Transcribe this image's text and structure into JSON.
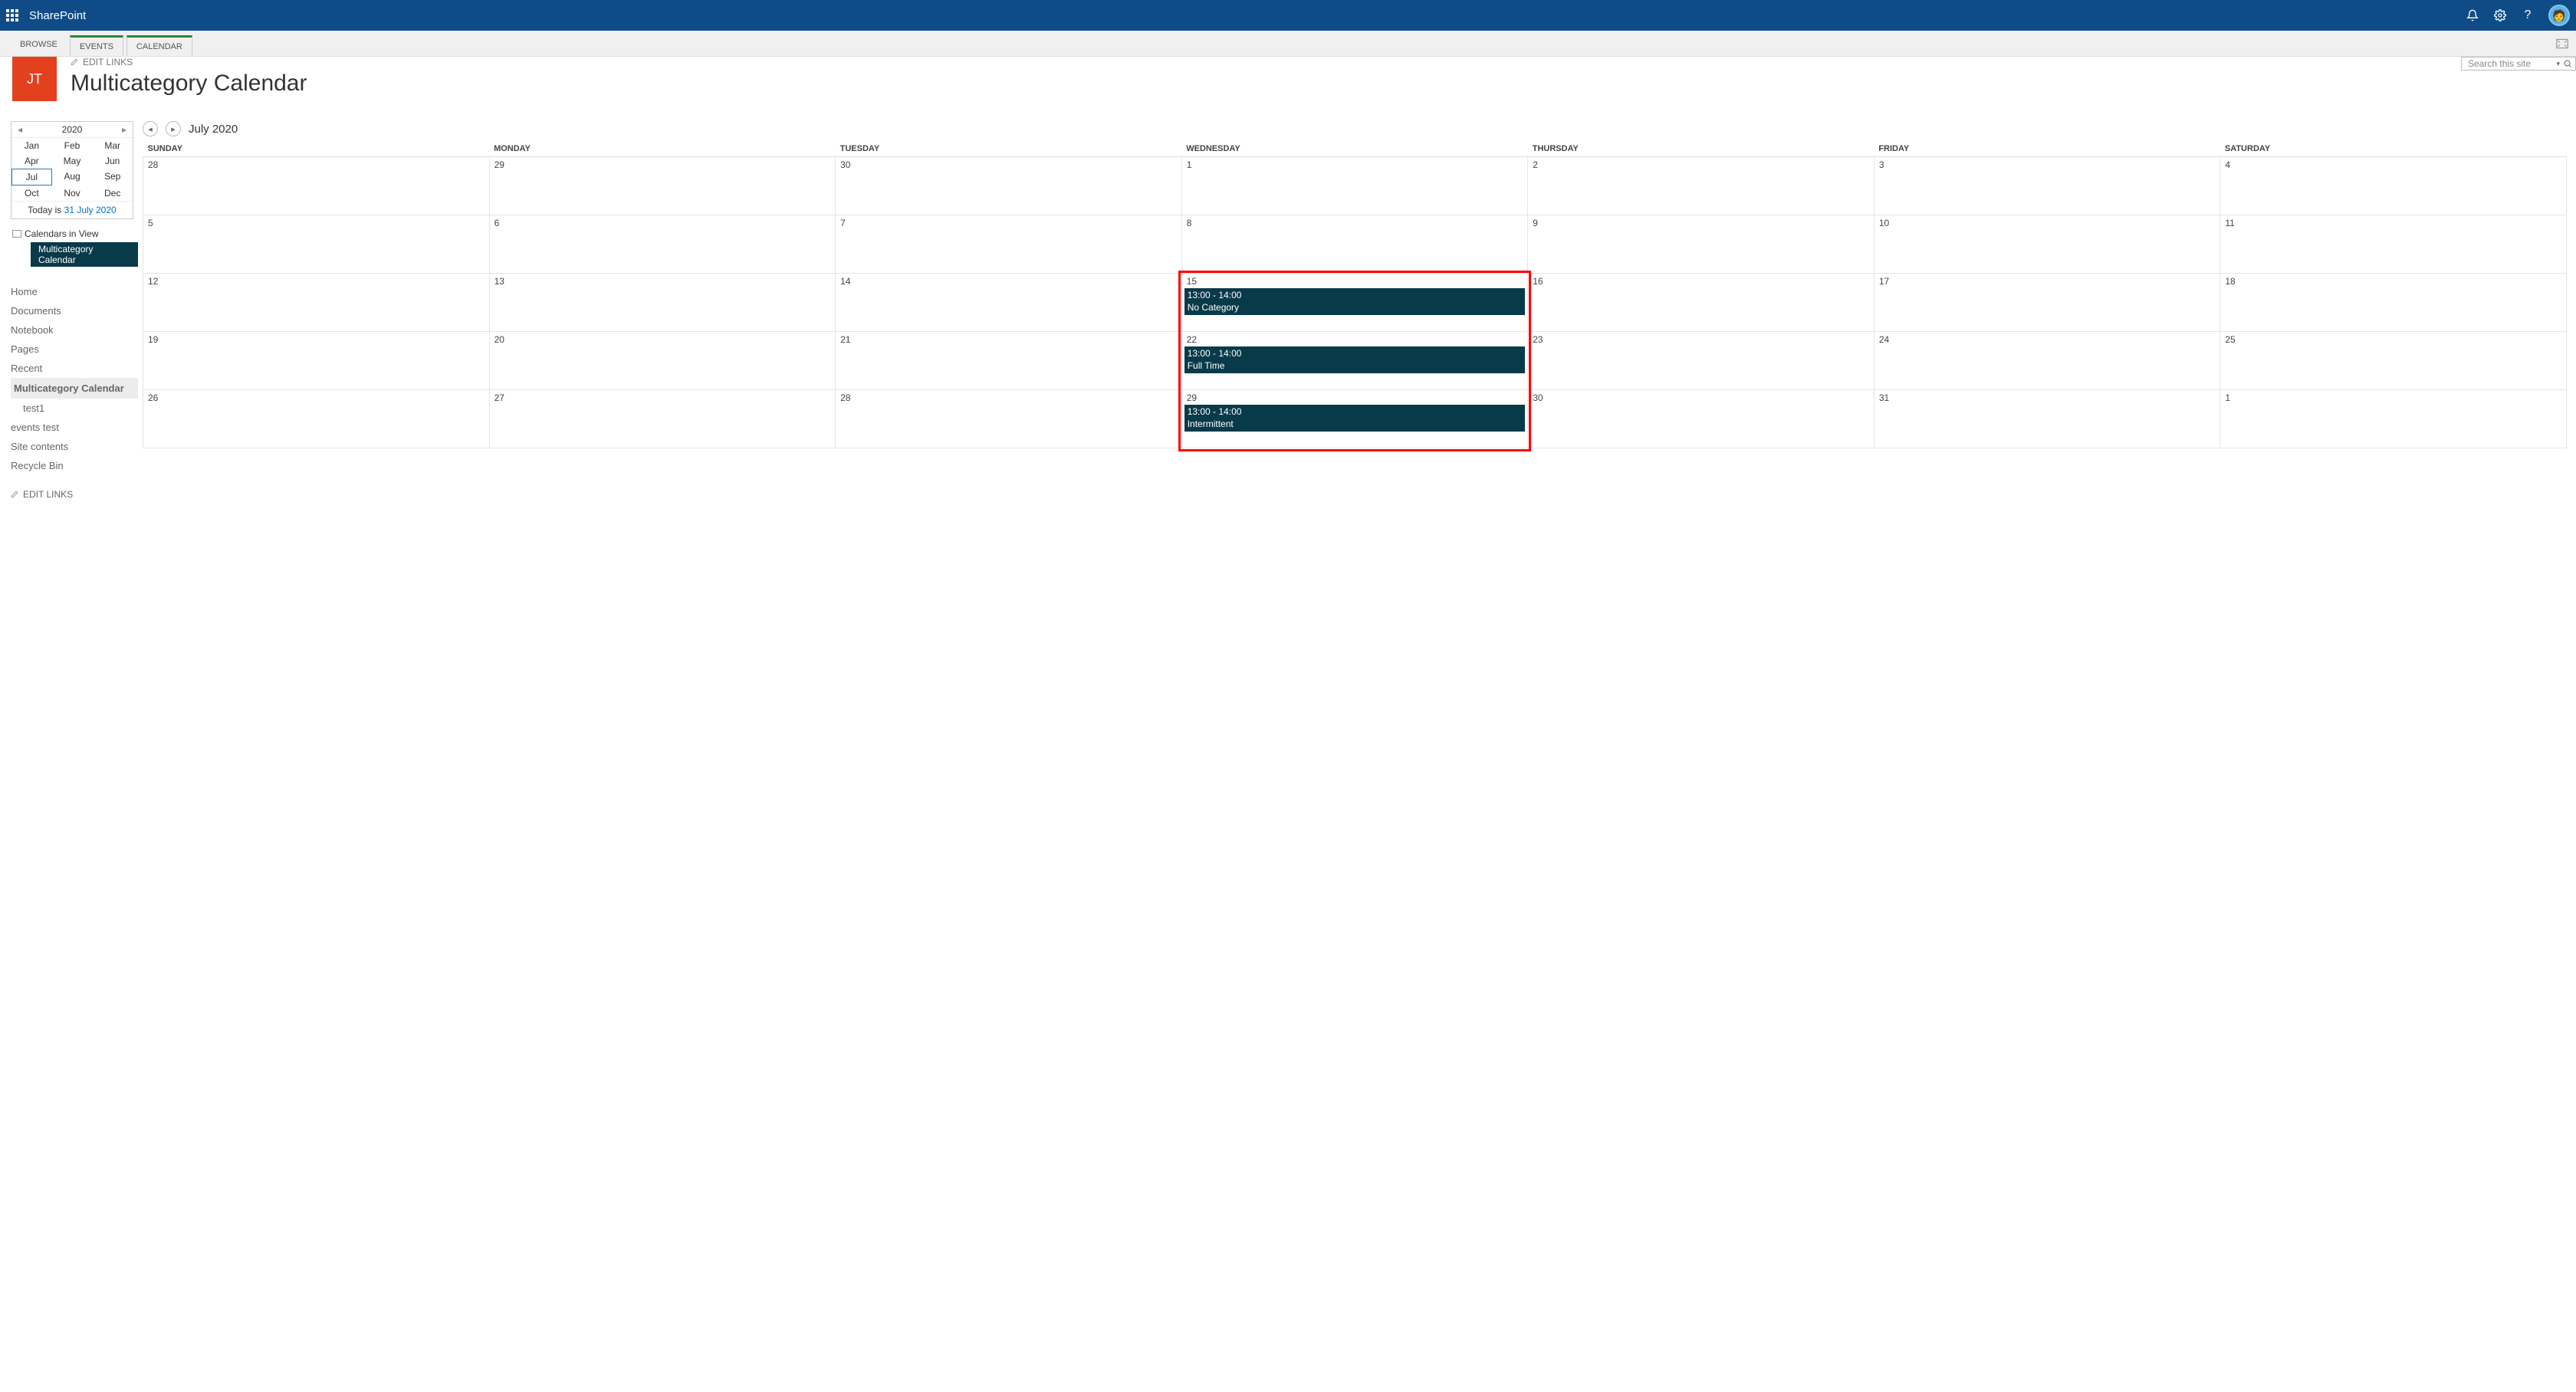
{
  "suite": {
    "brand": "SharePoint"
  },
  "ribbon": {
    "tabs": [
      "BROWSE",
      "EVENTS",
      "CALENDAR"
    ]
  },
  "site": {
    "logo_text": "JT",
    "edit_links": "EDIT LINKS",
    "title": "Multicategory Calendar",
    "search_placeholder": "Search this site"
  },
  "minical": {
    "year": "2020",
    "months": [
      "Jan",
      "Feb",
      "Mar",
      "Apr",
      "May",
      "Jun",
      "Jul",
      "Aug",
      "Sep",
      "Oct",
      "Nov",
      "Dec"
    ],
    "selected": "Jul",
    "today_label": "Today is ",
    "today_date": "31 July 2020"
  },
  "cals_in_view": {
    "label": "Calendars in View",
    "item": "Multicategory Calendar"
  },
  "nav": {
    "items": [
      "Home",
      "Documents",
      "Notebook",
      "Pages",
      "Recent"
    ],
    "recent_sub": [
      "Multicategory Calendar",
      "test1"
    ],
    "after": [
      "events test",
      "Site contents",
      "Recycle Bin"
    ],
    "edit_links": "EDIT LINKS"
  },
  "calendar": {
    "title": "July 2020",
    "days": [
      "SUNDAY",
      "MONDAY",
      "TUESDAY",
      "WEDNESDAY",
      "THURSDAY",
      "FRIDAY",
      "SATURDAY"
    ],
    "weeks": [
      [
        "28",
        "29",
        "30",
        "1",
        "2",
        "3",
        "4"
      ],
      [
        "5",
        "6",
        "7",
        "8",
        "9",
        "10",
        "11"
      ],
      [
        "12",
        "13",
        "14",
        "15",
        "16",
        "17",
        "18"
      ],
      [
        "19",
        "20",
        "21",
        "22",
        "23",
        "24",
        "25"
      ],
      [
        "26",
        "27",
        "28",
        "29",
        "30",
        "31",
        "1"
      ]
    ],
    "events": {
      "2_3": {
        "time": "13:00 - 14:00",
        "title": "No Category"
      },
      "3_3": {
        "time": "13:00 - 14:00",
        "title": "Full Time"
      },
      "4_3": {
        "time": "13:00 - 14:00",
        "title": "Intermittent"
      }
    }
  }
}
